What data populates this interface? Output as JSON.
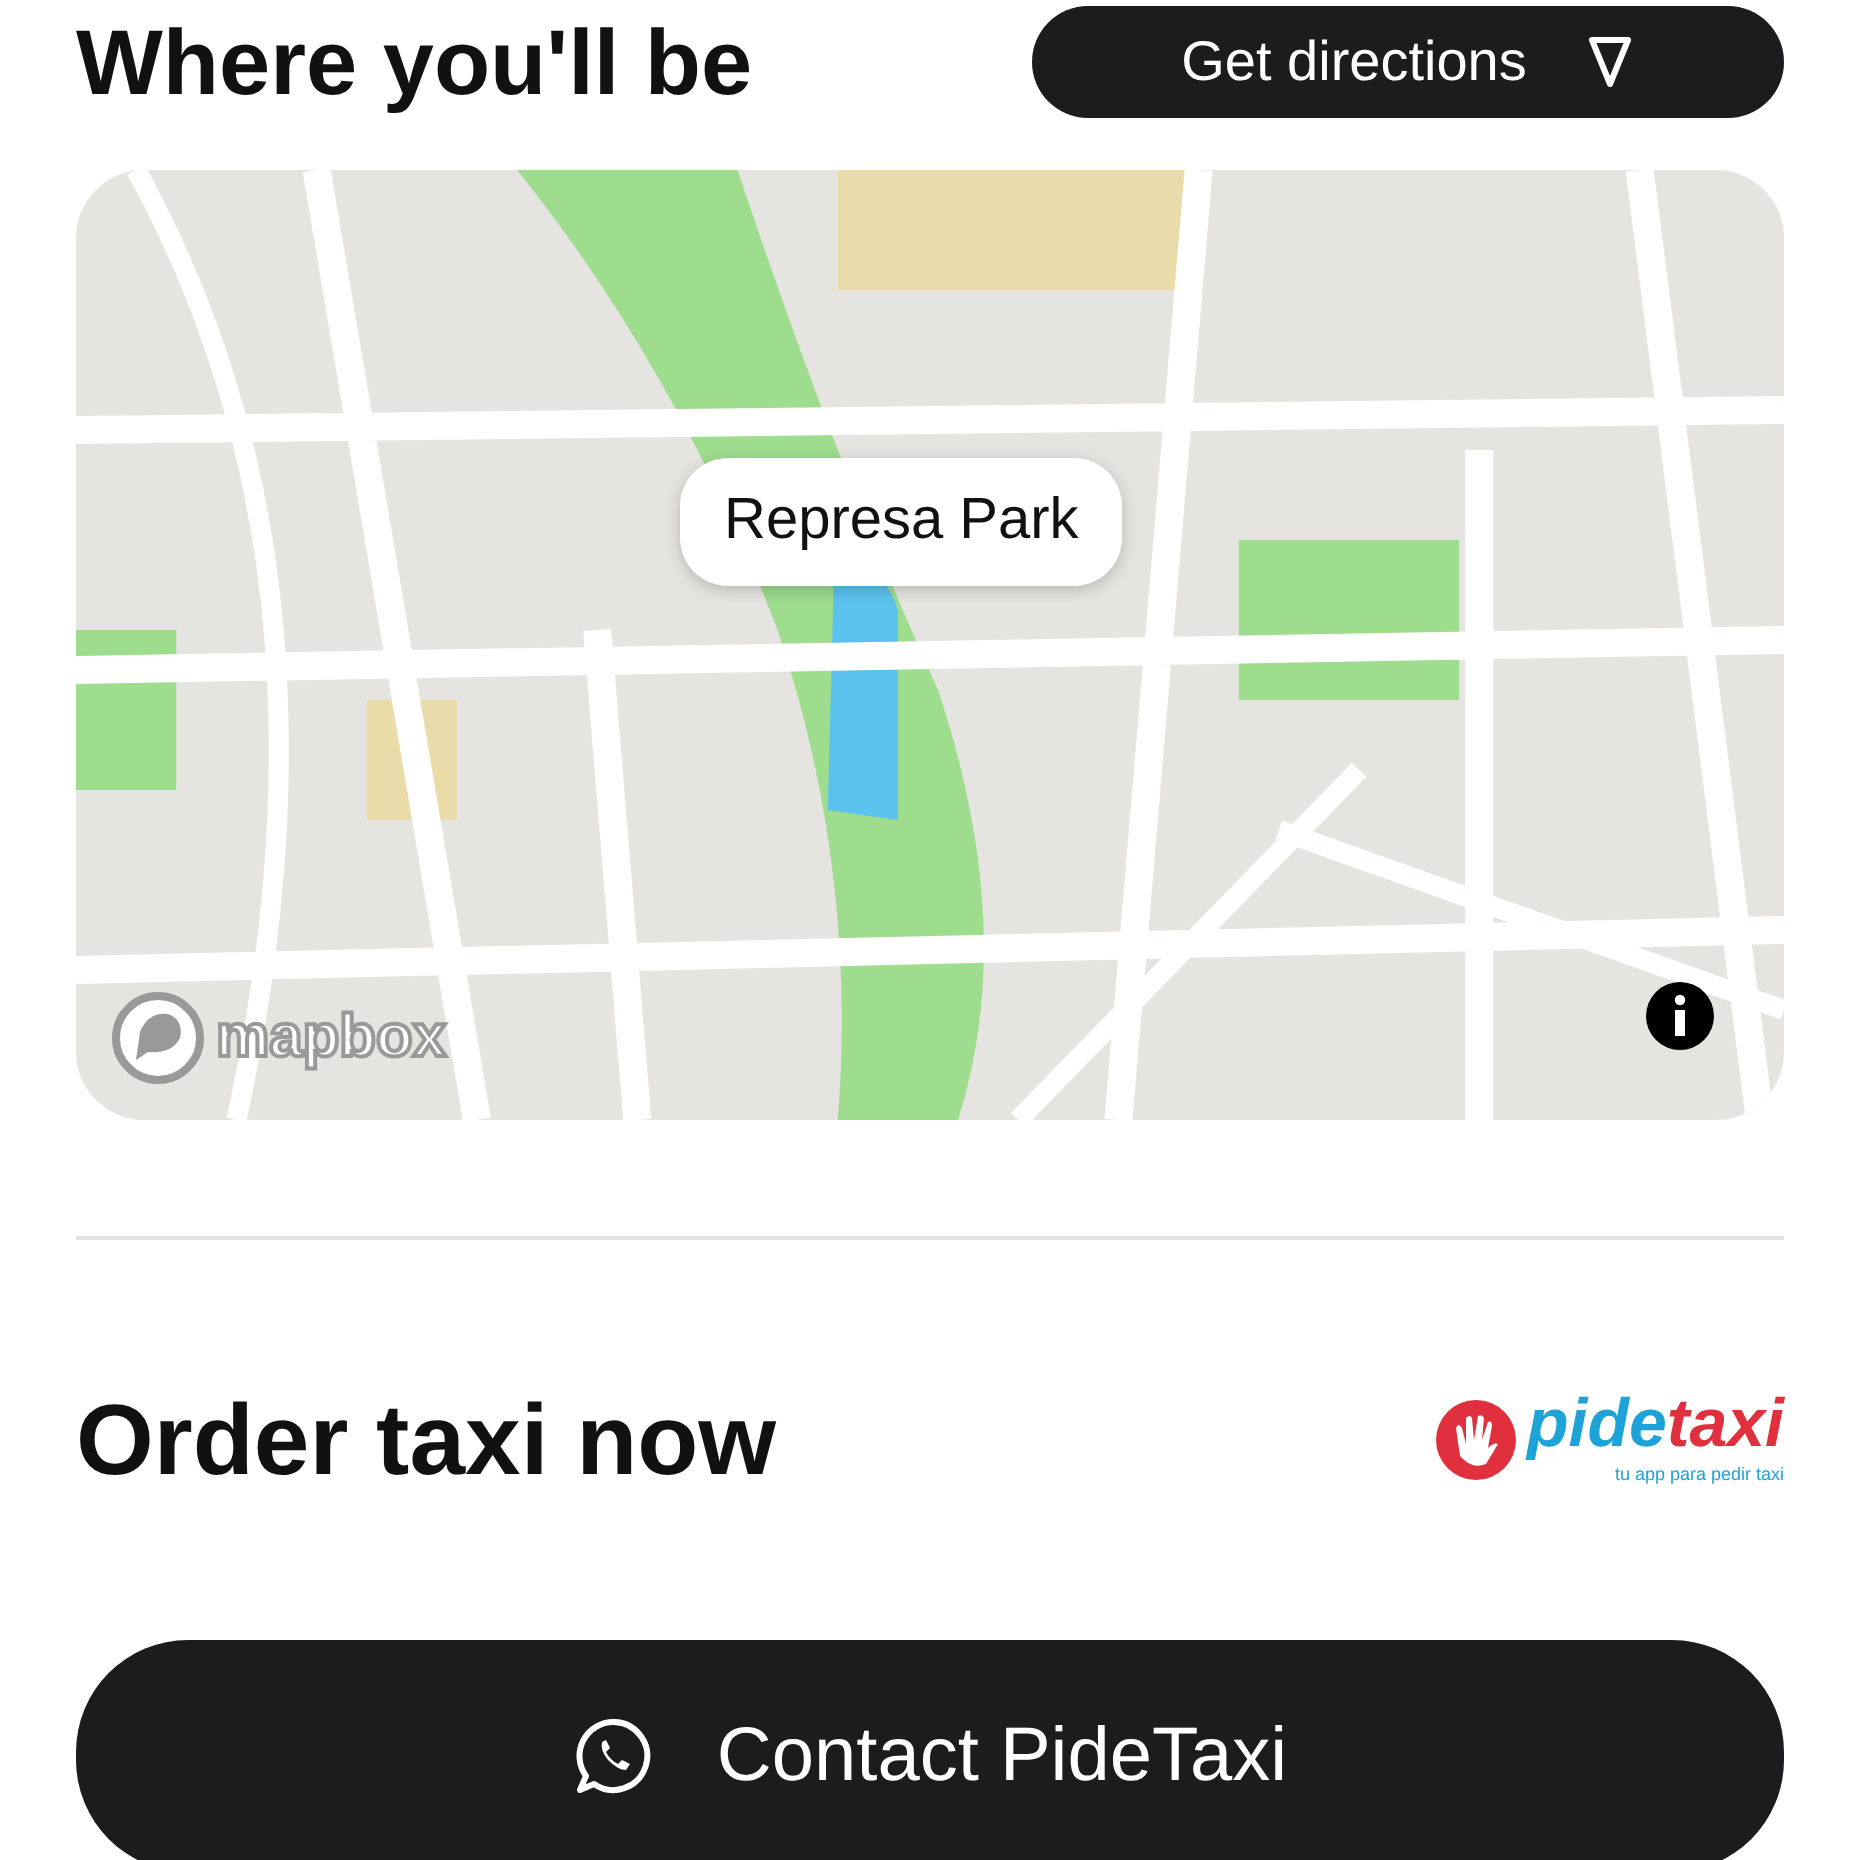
{
  "header": {
    "title": "Where you'll be",
    "directions_button": "Get directions"
  },
  "map": {
    "kind": "picture",
    "marker_label": "Represa Park",
    "attribution": "mapbox"
  },
  "order": {
    "title": "Order taxi now",
    "logo": {
      "part_1": "pide",
      "part_2": "taxi",
      "tagline": "tu app para pedir taxi"
    }
  },
  "contact_button": "Contact PideTaxi"
}
